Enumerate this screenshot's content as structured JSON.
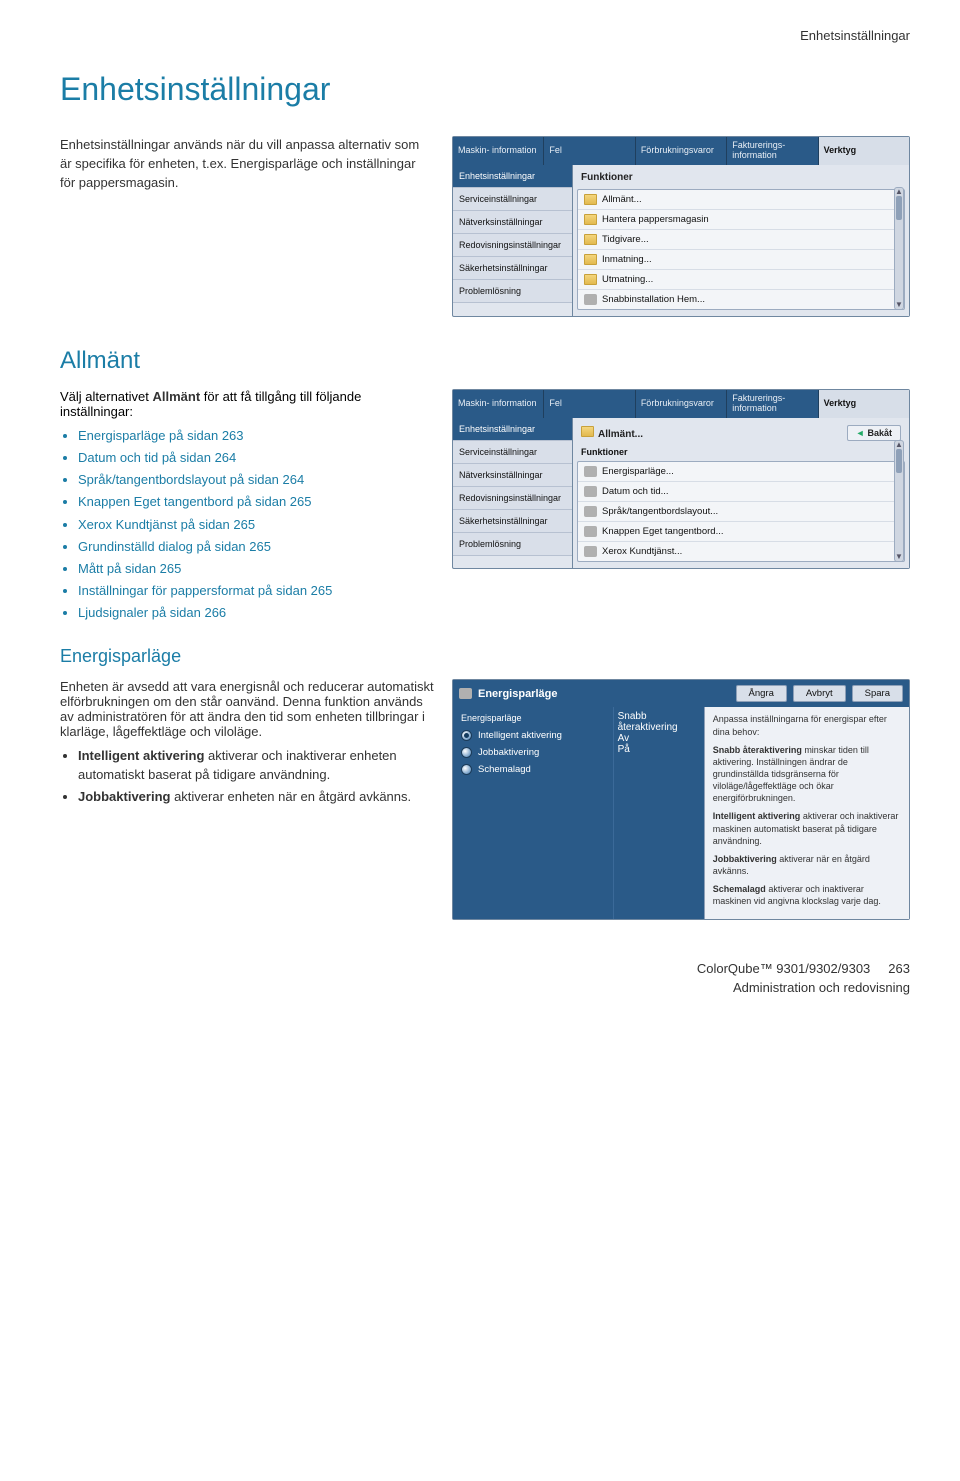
{
  "header_right": "Enhetsinställningar",
  "page_title": "Enhetsinställningar",
  "intro": "Enhetsinställningar används när du vill anpassa alternativ som är specifika för enheten, t.ex. Energisparläge och inställningar för pappersmagasin.",
  "allmant": {
    "heading": "Allmänt",
    "lead": "Välj alternativet Allmänt för att få tillgång till följande inställningar:",
    "bullets": [
      "Energisparläge på sidan 263",
      "Datum och tid på sidan 264",
      "Språk/tangentbordslayout på sidan 264",
      "Knappen Eget tangentbord på sidan 265",
      "Xerox Kundtjänst på sidan 265",
      "Grundinställd dialog på sidan 265",
      "Mått på sidan 265",
      "Inställningar för pappersformat på sidan 265",
      "Ljudsignaler på sidan 266"
    ]
  },
  "esp": {
    "heading": "Energisparläge",
    "para1": "Enheten är avsedd att vara energisnål och reducerar automatiskt elförbrukningen om den står oanvänd. Denna funktion används av administratören för att ändra den tid som enheten tillbringar i klarläge, lågeffektläge och viloläge.",
    "b1_bold": "Intelligent aktivering",
    "b1_rest": " aktiverar och inaktiverar enheten automatiskt baserat på tidigare användning.",
    "b2_bold": "Jobbaktivering",
    "b2_rest": " aktiverar enheten när en åtgärd avkänns."
  },
  "panel1": {
    "tabs": [
      "Maskin-\ninformation",
      "Fel",
      "Förbrukningsvaror",
      "Fakturerings-\ninformation",
      "Verktyg"
    ],
    "side": [
      "Enhetsinställningar",
      "Serviceinställningar",
      "Nätverksinställningar",
      "Redovisningsinställningar",
      "Säkerhetsinställningar",
      "Problemlösning"
    ],
    "subhead": "Funktioner",
    "rows": [
      {
        "t": "folder",
        "l": "Allmänt..."
      },
      {
        "t": "folder",
        "l": "Hantera pappersmagasin"
      },
      {
        "t": "folder",
        "l": "Tidgivare..."
      },
      {
        "t": "folder",
        "l": "Inmatning..."
      },
      {
        "t": "folder",
        "l": "Utmatning..."
      },
      {
        "t": "tool",
        "l": "Snabbinstallation Hem..."
      }
    ]
  },
  "panel2": {
    "subhead": "Allmänt...",
    "subhead2": "Funktioner",
    "bakat": "Bakåt",
    "rows": [
      {
        "t": "tool",
        "l": "Energisparläge..."
      },
      {
        "t": "tool",
        "l": "Datum och tid..."
      },
      {
        "t": "tool",
        "l": "Språk/tangentbordslayout..."
      },
      {
        "t": "tool",
        "l": "Knappen Eget tangentbord..."
      },
      {
        "t": "tool",
        "l": "Xerox Kundtjänst..."
      }
    ]
  },
  "panel3": {
    "title": "Energisparläge",
    "buttons": [
      "Ångra",
      "Avbryt",
      "Spara"
    ],
    "col1": {
      "h": "Energisparläge",
      "opts": [
        "Intelligent aktivering",
        "Jobbaktivering",
        "Schemalagd"
      ]
    },
    "col2": {
      "h": "Snabb återaktivering",
      "opts": [
        "Av",
        "På"
      ]
    },
    "desc_head": "Anpassa inställningarna för energispar efter dina behov:",
    "d1b": "Snabb återaktivering",
    "d1": " minskar tiden till aktivering. Inställningen ändrar de grundinställda tidsgränserna för viloläge/lågeffektläge och ökar energiförbrukningen.",
    "d2b": "Intelligent aktivering",
    "d2": " aktiverar och inaktiverar maskinen automatiskt baserat på tidigare användning.",
    "d3b": "Jobbaktivering",
    "d3": " aktiverar när en åtgärd avkänns.",
    "d4b": "Schemalagd",
    "d4": " aktiverar och inaktiverar maskinen vid angivna klockslag varje dag."
  },
  "footer": {
    "l1": "ColorQube™ 9301/9302/9303",
    "l2": "Administration och redovisning",
    "page": "263"
  }
}
